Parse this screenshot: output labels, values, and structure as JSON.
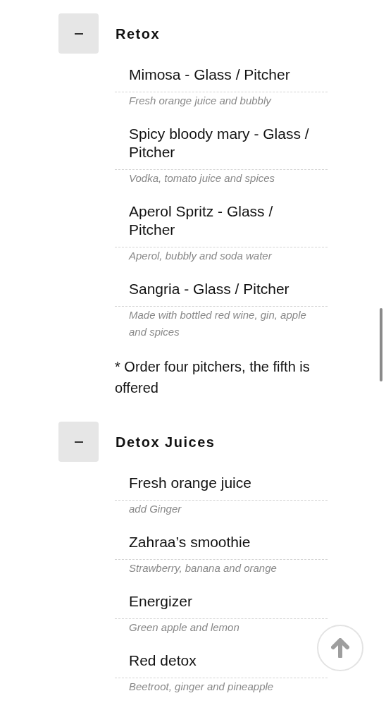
{
  "sections": [
    {
      "title": "Retox",
      "expanded": true,
      "items": [
        {
          "name": "Mimosa - Glass / Pitcher",
          "description": "Fresh orange juice and bubbly"
        },
        {
          "name": "Spicy bloody mary - Glass / Pitcher",
          "description": "Vodka, tomato juice and spices"
        },
        {
          "name": "Aperol Spritz - Glass / Pitcher",
          "description": "Aperol, bubbly and soda water"
        },
        {
          "name": "Sangria - Glass / Pitcher",
          "description": "Made with bottled red wine, gin, apple and spices"
        }
      ],
      "note": "* Order four pitchers, the fifth is offered"
    },
    {
      "title": "Detox Juices",
      "expanded": true,
      "items": [
        {
          "name": "Fresh orange juice",
          "description": "add Ginger"
        },
        {
          "name": "Zahraa’s smoothie",
          "description": "Strawberry, banana and orange"
        },
        {
          "name": "Energizer",
          "description": "Green apple and lemon"
        },
        {
          "name": "Red detox",
          "description": "Beetroot, ginger and pineapple"
        }
      ]
    }
  ]
}
